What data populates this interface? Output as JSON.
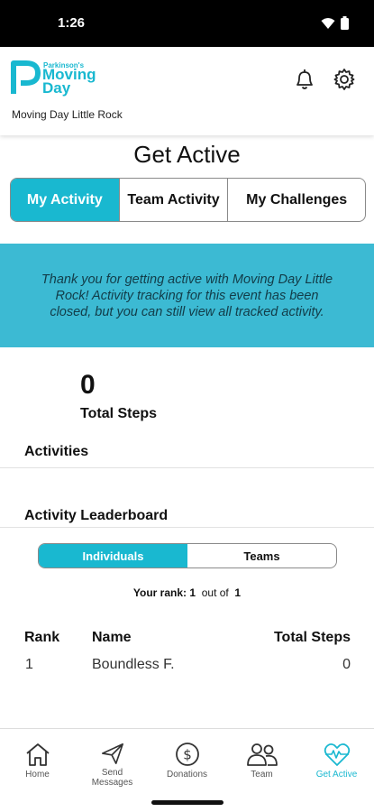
{
  "status_bar": {
    "time": "1:26"
  },
  "header": {
    "logo_small": "Parkinson's",
    "logo_big": "Moving Day",
    "event_name": "Moving Day Little Rock"
  },
  "page": {
    "title": "Get Active"
  },
  "tabs": [
    {
      "label": "My Activity",
      "active": true
    },
    {
      "label": "Team Activity",
      "active": false
    },
    {
      "label": "My Challenges",
      "active": false
    }
  ],
  "notice": {
    "text": "Thank you for getting active with Moving Day Little Rock! Activity tracking for this event has been closed, but you can still view all tracked activity."
  },
  "steps": {
    "value": "0",
    "label": "Total Steps"
  },
  "sections": {
    "activities": "Activities",
    "leaderboard": "Activity Leaderboard"
  },
  "leaderboard_toggle": {
    "individuals": "Individuals",
    "teams": "Teams"
  },
  "rank_summary": {
    "prefix": "Your rank:",
    "rank": "1",
    "middle": "out of",
    "total": "1"
  },
  "leaderboard": {
    "columns": {
      "rank": "Rank",
      "name": "Name",
      "steps": "Total Steps"
    },
    "rows": [
      {
        "rank": "1",
        "name": "Boundless F.",
        "steps": "0"
      }
    ]
  },
  "nav": [
    {
      "label": "Home",
      "icon": "home-icon"
    },
    {
      "label": "Send Messages",
      "icon": "send-icon"
    },
    {
      "label": "Donations",
      "icon": "dollar-icon"
    },
    {
      "label": "Team",
      "icon": "team-icon"
    },
    {
      "label": "Get Active",
      "icon": "heartbeat-icon",
      "active": true
    }
  ],
  "colors": {
    "accent": "#19b8d0",
    "notice_bg": "#3cbad3"
  }
}
